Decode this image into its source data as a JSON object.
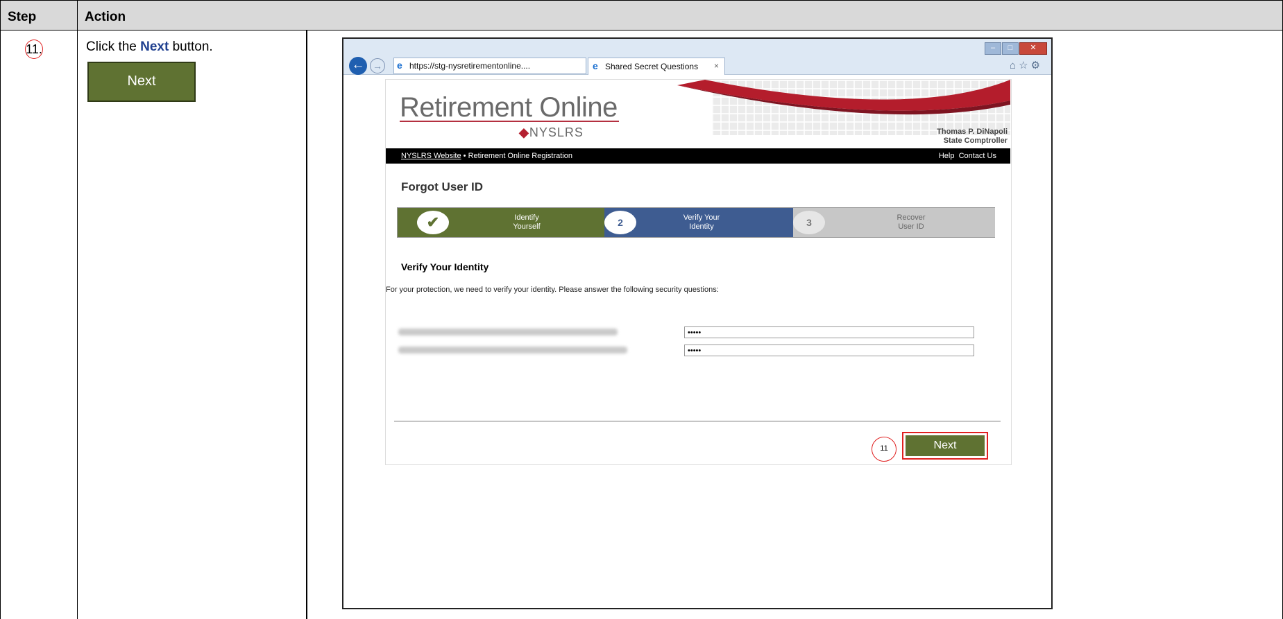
{
  "table": {
    "header_step": "Step",
    "header_action": "Action",
    "step_number": "11.",
    "instruction_prefix": "Click the ",
    "instruction_bold": "Next",
    "instruction_suffix": " button.",
    "sample_button": "Next"
  },
  "browser": {
    "url": "https://stg-nysretirementonline.... ⌕ ▾ 🔒 ↻",
    "url_text": "https://stg-nysretirementonline....",
    "tab_title": "Shared Secret Questions",
    "tab_close": "×",
    "right_icons": "⌂☆⚙"
  },
  "site": {
    "logo_main": "Retirement Online",
    "logo_sub": "NYSLRS",
    "comptroller_name": "Thomas P. DiNapoli",
    "comptroller_title": "State Comptroller",
    "nav_link": "NYSLRS Website",
    "nav_sep": " • ",
    "nav_text": "Retirement Online Registration",
    "nav_help": "Help",
    "nav_contact": "Contact Us"
  },
  "form": {
    "page_title": "Forgot User ID",
    "steps": [
      {
        "marker": "✔",
        "label_line1": "Identify",
        "label_line2": "Yourself"
      },
      {
        "marker": "2",
        "label_line1": "Verify Your",
        "label_line2": "Identity"
      },
      {
        "marker": "3",
        "label_line1": "Recover",
        "label_line2": "User ID"
      }
    ],
    "section_title": "Verify Your Identity",
    "protection_text": "For your protection, we need to verify your identity. Please answer the following security questions:",
    "answers": [
      "•••••",
      "•••••"
    ],
    "callout_number": "11",
    "next_button": "Next"
  }
}
